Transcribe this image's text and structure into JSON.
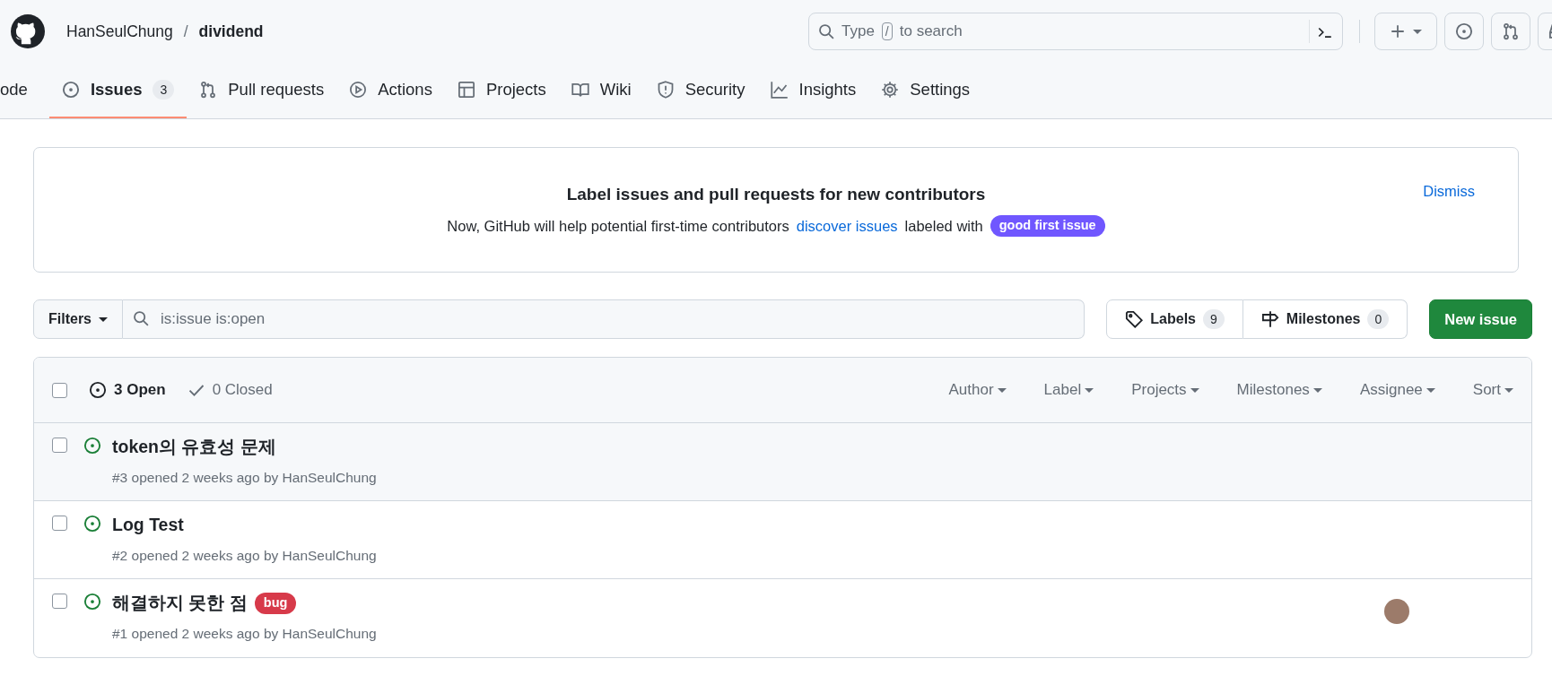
{
  "header": {
    "owner": "HanSeulChung",
    "separator": "/",
    "repo": "dividend",
    "search": {
      "placeholder_parts": [
        "Type",
        "/",
        "to search"
      ]
    }
  },
  "tabs": [
    {
      "label": "ode",
      "selected": false
    },
    {
      "label": "Issues",
      "selected": true,
      "counter": "3"
    },
    {
      "label": "Pull requests",
      "selected": false
    },
    {
      "label": "Actions",
      "selected": false
    },
    {
      "label": "Projects",
      "selected": false
    },
    {
      "label": "Wiki",
      "selected": false
    },
    {
      "label": "Security",
      "selected": false
    },
    {
      "label": "Insights",
      "selected": false
    },
    {
      "label": "Settings",
      "selected": false
    }
  ],
  "banner": {
    "title": "Label issues and pull requests for new contributors",
    "text_before": "Now, GitHub will help potential first-time contributors",
    "link": "discover issues",
    "text_after": "labeled with",
    "label": {
      "name": "good first issue",
      "color": "#7057ff"
    },
    "dismiss": "Dismiss"
  },
  "toolbar": {
    "filters": "Filters",
    "search_value": "is:issue is:open",
    "labels": {
      "label": "Labels",
      "count": "9"
    },
    "milestones": {
      "label": "Milestones",
      "count": "0"
    },
    "new_issue": "New issue"
  },
  "list_header": {
    "checked": false,
    "open": "3 Open",
    "closed": "0 Closed",
    "filters": [
      "Author",
      "Label",
      "Projects",
      "Milestones",
      "Assignee",
      "Sort"
    ]
  },
  "issues": [
    {
      "title": "token의 유효성 문제",
      "meta": "#3 opened 2 weeks ago by HanSeulChung",
      "hovered": true,
      "checked": false,
      "assigned": false
    },
    {
      "title": "Log Test",
      "meta": "#2 opened 2 weeks ago by HanSeulChung",
      "hovered": false,
      "checked": false,
      "assigned": false
    },
    {
      "title": "해결하지 못한 점",
      "meta": "#1 opened 2 weeks ago by HanSeulChung",
      "hovered": false,
      "checked": false,
      "assigned": true,
      "labels": [
        {
          "name": "bug",
          "color": "#d73a4a"
        }
      ]
    }
  ]
}
